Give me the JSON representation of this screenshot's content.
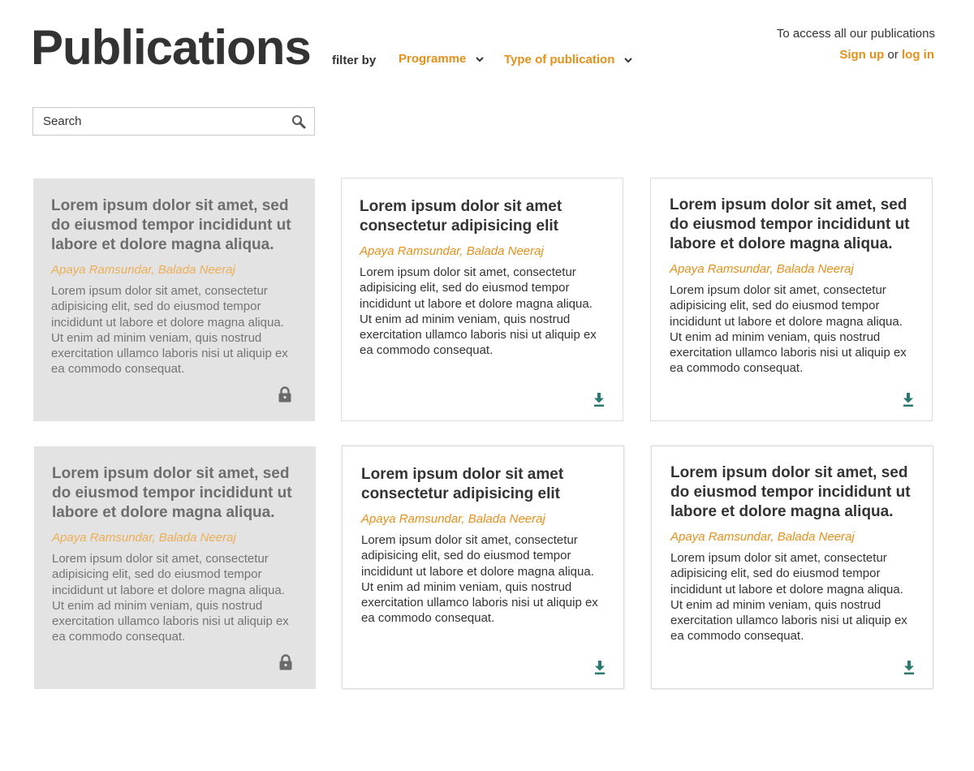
{
  "header": {
    "title": "Publications",
    "filter_label": "filter by",
    "filters": [
      {
        "label": "Programme",
        "icon": "chevron-down-icon"
      },
      {
        "label": "Type of publication",
        "icon": "chevron-down-icon"
      }
    ]
  },
  "access": {
    "text": "To access all our publications",
    "sign_up": "Sign up",
    "or": "or",
    "log_in": "log in"
  },
  "search": {
    "placeholder": "Search",
    "icon": "search-icon"
  },
  "colors": {
    "accent": "#e5901a",
    "locked_card_bg": "#e3e3e3",
    "download_icon": "#2b7a6f",
    "lock_icon": "#6a6a6a",
    "text_dark": "#333333"
  },
  "cards": [
    {
      "title": "Lorem ipsum dolor sit amet, sed do eiusmod tempor incididunt ut labore et dolore magna aliqua.",
      "authors": "Apaya Ramsundar, Balada Neeraj",
      "description": "Lorem ipsum dolor sit amet, consectetur adipisicing elit, sed do eiusmod tempor incididunt ut labore et dolore magna aliqua. Ut enim ad minim veniam, quis nostrud exercitation ullamco laboris nisi ut aliquip ex ea commodo consequat.",
      "status": "locked",
      "icon": "lock-icon"
    },
    {
      "title": "Lorem ipsum dolor sit amet consectetur adipisicing elit",
      "authors": "Apaya Ramsundar, Balada Neeraj",
      "description": "Lorem ipsum dolor sit amet, consectetur adipisicing elit, sed do eiusmod tempor incididunt ut labore et dolore magna aliqua. Ut enim ad minim veniam, quis nostrud exercitation ullamco laboris nisi ut aliquip ex ea commodo consequat.",
      "status": "open",
      "icon": "download-icon"
    },
    {
      "title": "Lorem ipsum dolor sit amet, sed do eiusmod tempor incididunt ut labore et dolore magna aliqua.",
      "authors": "Apaya Ramsundar, Balada Neeraj",
      "description": "Lorem ipsum dolor sit amet, consectetur adipisicing elit, sed do eiusmod tempor incididunt ut labore et dolore magna aliqua. Ut enim ad minim veniam, quis nostrud exercitation ullamco laboris nisi ut aliquip ex ea commodo consequat.",
      "status": "open",
      "icon": "download-icon"
    },
    {
      "title": "Lorem ipsum dolor sit amet, sed do eiusmod tempor incididunt ut labore et dolore magna aliqua.",
      "authors": "Apaya Ramsundar, Balada Neeraj",
      "description": "Lorem ipsum dolor sit amet, consectetur adipisicing elit, sed do eiusmod tempor incididunt ut labore et dolore magna aliqua. Ut enim ad minim veniam, quis nostrud exercitation ullamco laboris nisi ut aliquip ex ea commodo consequat.",
      "status": "locked",
      "icon": "lock-icon"
    },
    {
      "title": "Lorem ipsum dolor sit amet consectetur adipisicing elit",
      "authors": "Apaya Ramsundar, Balada Neeraj",
      "description": "Lorem ipsum dolor sit amet, consectetur adipisicing elit, sed do eiusmod tempor incididunt ut labore et dolore magna aliqua. Ut enim ad minim veniam, quis nostrud exercitation ullamco laboris nisi ut aliquip ex ea commodo consequat.",
      "status": "open",
      "icon": "download-icon"
    },
    {
      "title": "Lorem ipsum dolor sit amet, sed do eiusmod tempor incididunt ut labore et dolore magna aliqua.",
      "authors": "Apaya Ramsundar, Balada Neeraj",
      "description": "Lorem ipsum dolor sit amet, consectetur adipisicing elit, sed do eiusmod tempor incididunt ut labore et dolore magna aliqua. Ut enim ad minim veniam, quis nostrud exercitation ullamco laboris nisi ut aliquip ex ea commodo consequat.",
      "status": "open",
      "icon": "download-icon"
    }
  ]
}
